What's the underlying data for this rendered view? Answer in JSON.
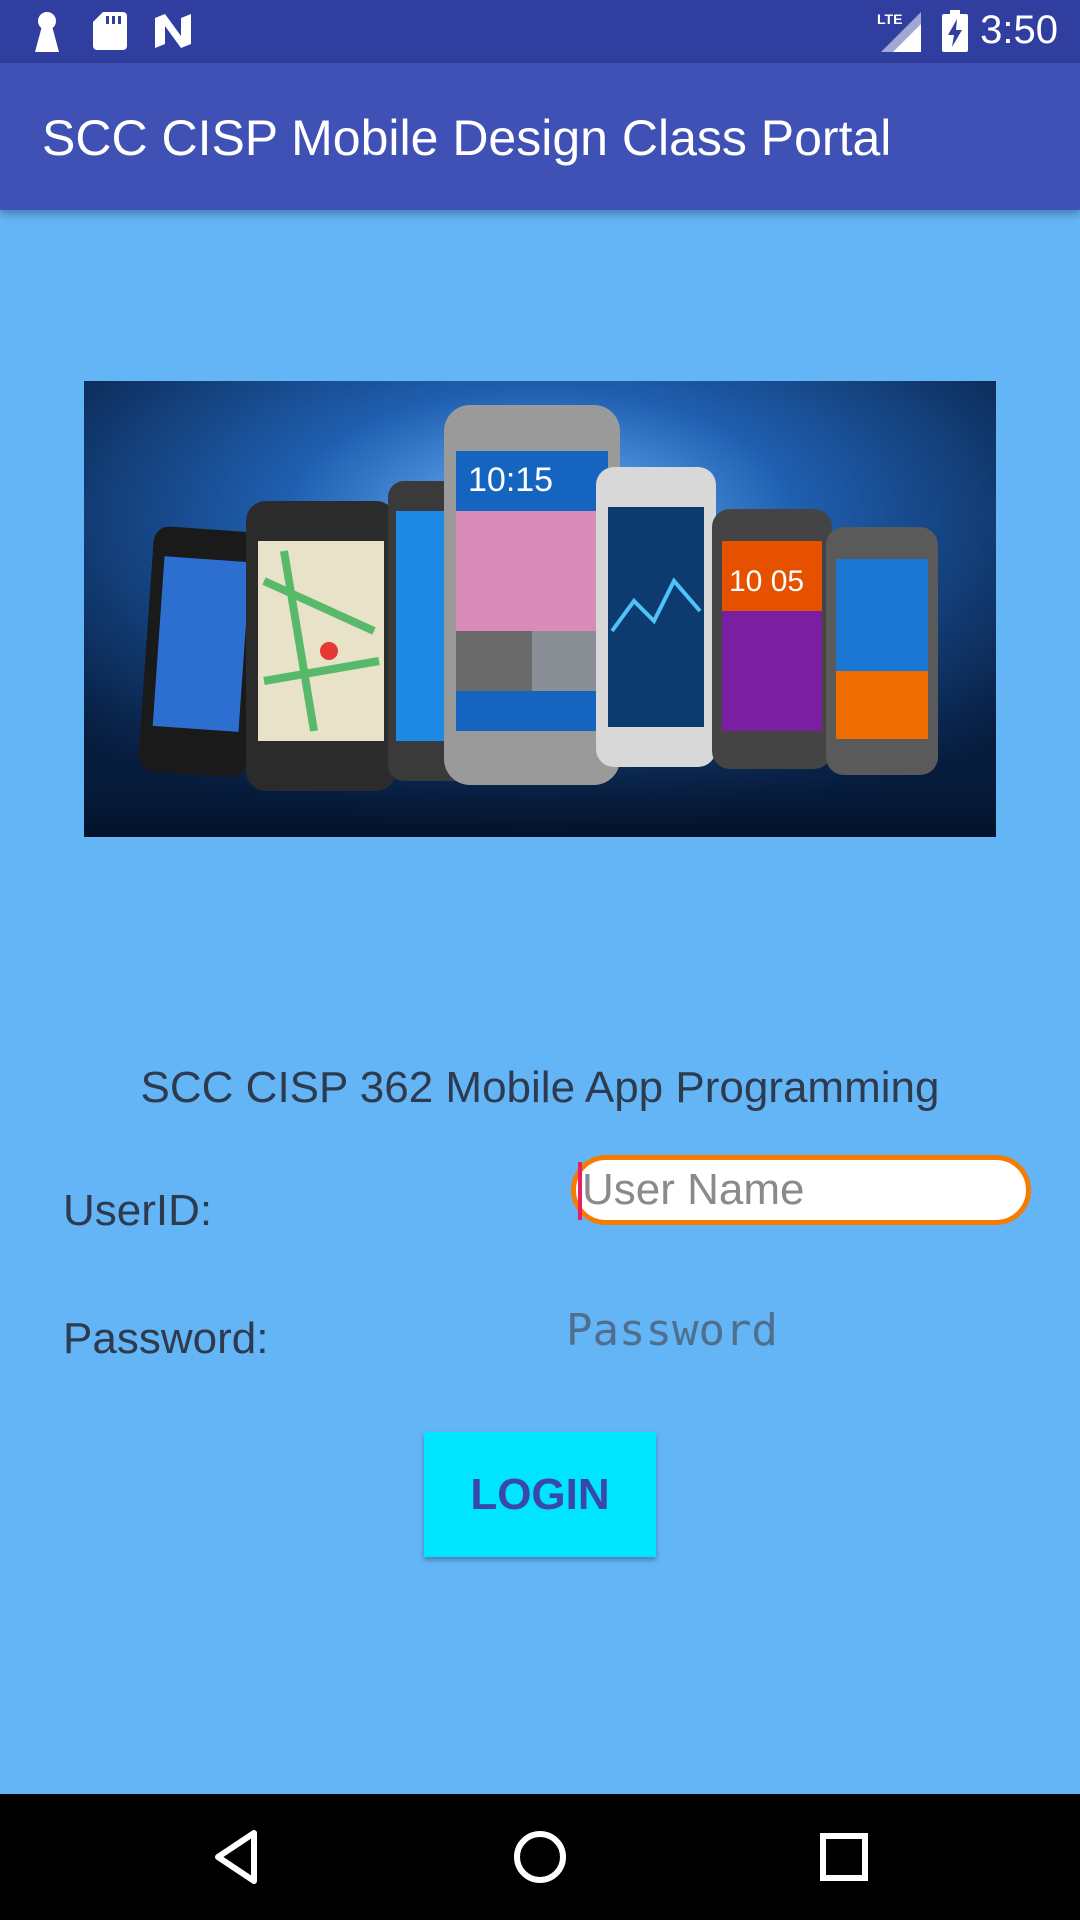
{
  "status_bar": {
    "time": "3:50",
    "left_icons": [
      "keyhole-icon",
      "sd-card-icon",
      "n-logo-icon"
    ],
    "right_icons": [
      "lte-signal-icon",
      "battery-charging-icon"
    ]
  },
  "app_bar": {
    "title": "SCC CISP Mobile Design Class Portal"
  },
  "banner": {
    "image": "smartphones-banner-image"
  },
  "subtitle": "SCC CISP 362 Mobile App Programming",
  "form": {
    "userid_label": "UserID:",
    "username_placeholder": "User Name",
    "password_label": "Password:",
    "password_placeholder": "Password",
    "login_label": "LOGIN"
  },
  "nav_bar": {
    "icons": [
      "back-icon",
      "home-icon",
      "recents-icon"
    ]
  },
  "colors": {
    "background": "#64b5f6",
    "app_bar": "#3f51b5",
    "status_bar": "#303f9f",
    "button": "#00e5ff",
    "button_text": "#3949ab",
    "focus_border": "#f57c00"
  }
}
